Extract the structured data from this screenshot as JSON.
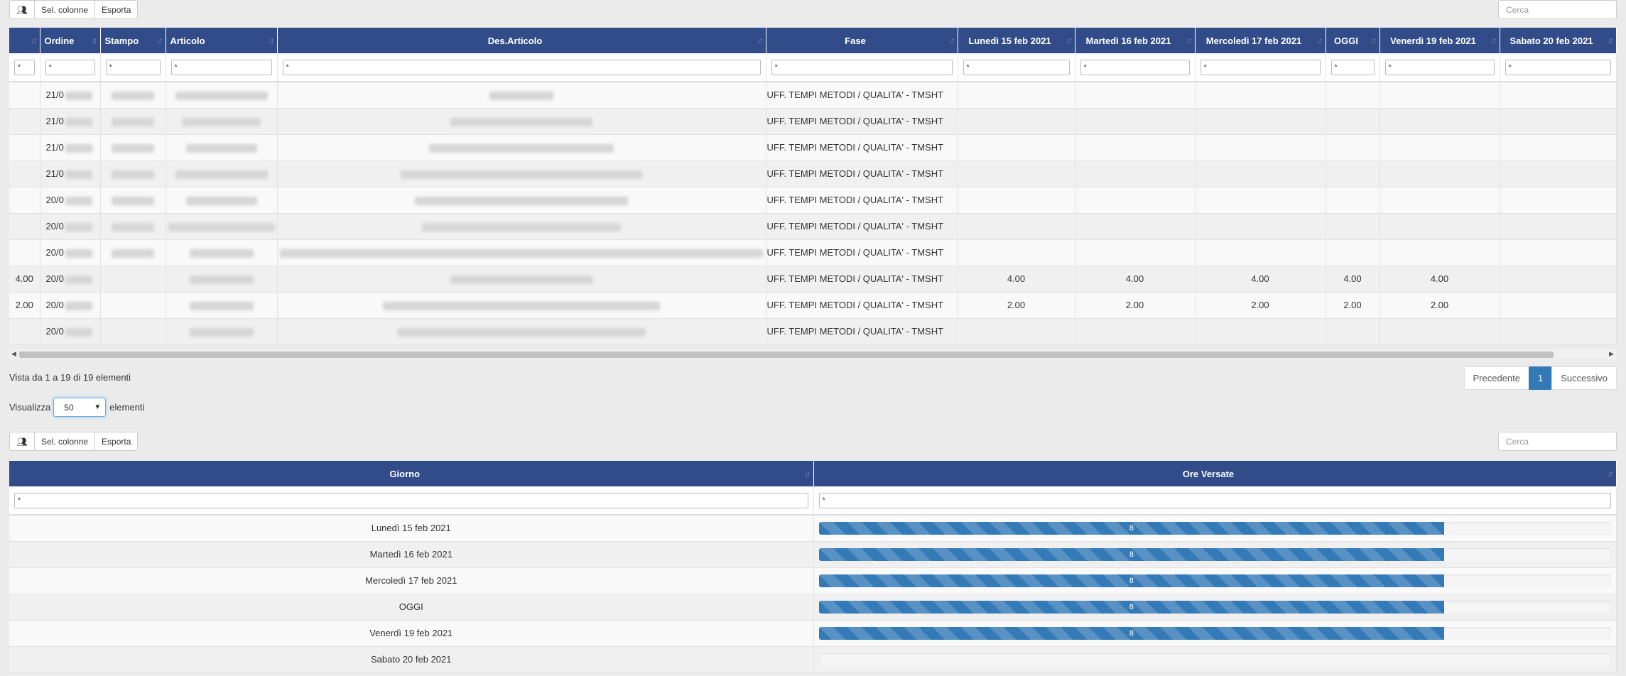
{
  "toolbar1": {
    "icon": "users-icon",
    "sel_colonne": "Sel. colonne",
    "esporta": "Esporta"
  },
  "search1": {
    "placeholder": "Cerca"
  },
  "table1": {
    "headers": [
      "",
      "Ordine",
      "Stampo",
      "Articolo",
      "Des.Articolo",
      "Fase",
      "Lunedì 15 feb 2021",
      "Martedì 16 feb 2021",
      "Mercoledì 17 feb 2021",
      "OGGI",
      "Venerdì 19 feb 2021",
      "Sabato 20 feb 2021"
    ],
    "filter_value": "*",
    "rows": [
      {
        "c0": "",
        "ordine": "21/0",
        "fase": "UFF. TEMPI METODI / QUALITA' - TMSHT",
        "d1": "",
        "d2": "",
        "d3": "",
        "d4": "",
        "d5": "",
        "d6": ""
      },
      {
        "c0": "",
        "ordine": "21/0",
        "fase": "UFF. TEMPI METODI / QUALITA' - TMSHT",
        "d1": "",
        "d2": "",
        "d3": "",
        "d4": "",
        "d5": "",
        "d6": ""
      },
      {
        "c0": "",
        "ordine": "21/0",
        "fase": "UFF. TEMPI METODI / QUALITA' - TMSHT",
        "d1": "",
        "d2": "",
        "d3": "",
        "d4": "",
        "d5": "",
        "d6": ""
      },
      {
        "c0": "",
        "ordine": "21/0",
        "fase": "UFF. TEMPI METODI / QUALITA' - TMSHT",
        "d1": "",
        "d2": "",
        "d3": "",
        "d4": "",
        "d5": "",
        "d6": ""
      },
      {
        "c0": "",
        "ordine": "20/0",
        "fase": "UFF. TEMPI METODI / QUALITA' - TMSHT",
        "d1": "",
        "d2": "",
        "d3": "",
        "d4": "",
        "d5": "",
        "d6": ""
      },
      {
        "c0": "",
        "ordine": "20/0",
        "fase": "UFF. TEMPI METODI / QUALITA' - TMSHT",
        "d1": "",
        "d2": "",
        "d3": "",
        "d4": "",
        "d5": "",
        "d6": ""
      },
      {
        "c0": "",
        "ordine": "20/0",
        "fase": "UFF. TEMPI METODI / QUALITA' - TMSHT",
        "d1": "",
        "d2": "",
        "d3": "",
        "d4": "",
        "d5": "",
        "d6": ""
      },
      {
        "c0": "4.00",
        "ordine": "20/0",
        "fase": "UFF. TEMPI METODI / QUALITA' - TMSHT",
        "d1": "4.00",
        "d2": "4.00",
        "d3": "4.00",
        "d4": "4.00",
        "d5": "4.00",
        "d6": ""
      },
      {
        "c0": "2.00",
        "ordine": "20/0",
        "fase": "UFF. TEMPI METODI / QUALITA' - TMSHT",
        "d1": "2.00",
        "d2": "2.00",
        "d3": "2.00",
        "d4": "2.00",
        "d5": "2.00",
        "d6": ""
      },
      {
        "c0": "",
        "ordine": "20/0",
        "fase": "UFF. TEMPI METODI / QUALITA' - TMSHT",
        "d1": "",
        "d2": "",
        "d3": "",
        "d4": "",
        "d5": "",
        "d6": ""
      }
    ]
  },
  "info": "Vista da 1 a 19 di 19 elementi",
  "pagination": {
    "prev": "Precedente",
    "page": "1",
    "next": "Successivo"
  },
  "page_length": {
    "label_before": "Visualizza",
    "value": "50",
    "label_after": "elementi"
  },
  "toolbar2": {
    "icon": "users-icon",
    "sel_colonne": "Sel. colonne",
    "esporta": "Esporta"
  },
  "search2": {
    "placeholder": "Cerca"
  },
  "table2": {
    "headers": [
      "Giorno",
      "Ore Versate"
    ],
    "filter_value": "*",
    "rows": [
      {
        "giorno": "Lunedì 15 feb 2021",
        "ore": "8",
        "fraction": 0.79
      },
      {
        "giorno": "Martedì 16 feb 2021",
        "ore": "8",
        "fraction": 0.79
      },
      {
        "giorno": "Mercoledì 17 feb 2021",
        "ore": "8",
        "fraction": 0.79
      },
      {
        "giorno": "OGGI",
        "ore": "8",
        "fraction": 0.79
      },
      {
        "giorno": "Venerdì 19 feb 2021",
        "ore": "8",
        "fraction": 0.79
      },
      {
        "giorno": "Sabato 20 feb 2021",
        "ore": "",
        "fraction": 0
      }
    ]
  }
}
